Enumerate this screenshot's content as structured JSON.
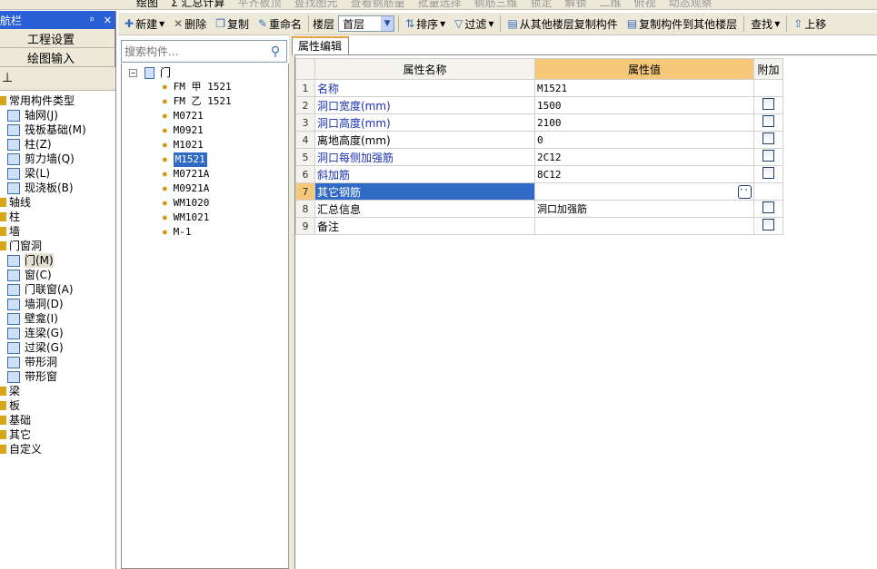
{
  "top_toolbar": [
    "绘图",
    "Σ 汇总计算",
    "平齐板顶",
    "查找图元",
    "查看钢筋量",
    "批量选择",
    "钢筋三维",
    "锁定",
    "解锁",
    "二维",
    "俯视",
    "动态观察"
  ],
  "nav": {
    "title": "航栏",
    "pin": "ᵖ",
    "close": "✕",
    "buttons": [
      "工程设置",
      "绘图输入"
    ],
    "tool": "⊥",
    "tree": [
      {
        "label": "常用构件类型",
        "type": "open",
        "level": 0
      },
      {
        "label": "轴网(J)",
        "level": 1
      },
      {
        "label": "筏板基础(M)",
        "level": 1
      },
      {
        "label": "柱(Z)",
        "level": 1
      },
      {
        "label": "剪力墙(Q)",
        "level": 1
      },
      {
        "label": "梁(L)",
        "level": 1
      },
      {
        "label": "现浇板(B)",
        "level": 1
      },
      {
        "label": "轴线",
        "type": "folder",
        "level": 0
      },
      {
        "label": "柱",
        "type": "folder",
        "level": 0
      },
      {
        "label": "墙",
        "type": "folder",
        "level": 0
      },
      {
        "label": "门窗洞",
        "type": "open",
        "level": 0
      },
      {
        "label": "门(M)",
        "level": 1,
        "selected": true
      },
      {
        "label": "窗(C)",
        "level": 1
      },
      {
        "label": "门联窗(A)",
        "level": 1
      },
      {
        "label": "墙洞(D)",
        "level": 1
      },
      {
        "label": "壁龛(I)",
        "level": 1
      },
      {
        "label": "连梁(G)",
        "level": 1
      },
      {
        "label": "过梁(G)",
        "level": 1
      },
      {
        "label": "带形洞",
        "level": 1
      },
      {
        "label": "带形窗",
        "level": 1
      },
      {
        "label": "梁",
        "type": "folder",
        "level": 0
      },
      {
        "label": "板",
        "type": "folder",
        "level": 0
      },
      {
        "label": "基础",
        "type": "folder",
        "level": 0
      },
      {
        "label": "其它",
        "type": "folder",
        "level": 0
      },
      {
        "label": "自定义",
        "type": "folder",
        "level": 0
      }
    ]
  },
  "toolbar": {
    "new": "新建",
    "delete": "删除",
    "copy": "复制",
    "rename": "重命名",
    "floor_label": "楼层",
    "floor_value": "首层",
    "sort": "排序",
    "filter": "过滤",
    "copy_from": "从其他楼层复制构件",
    "copy_to": "复制构件到其他楼层",
    "find": "查找",
    "move_up": "上移"
  },
  "search": {
    "placeholder": "搜索构件..."
  },
  "component_tree": {
    "root": "门",
    "items": [
      "FM 甲 1521",
      "FM 乙 1521",
      "M0721",
      "M0921",
      "M1021",
      "M1521",
      "M0721A",
      "M0921A",
      "WM1020",
      "WM1021",
      "M-1"
    ],
    "selected": "M1521"
  },
  "property": {
    "tab": "属性编辑",
    "headers": [
      "属性名称",
      "属性值",
      "附加"
    ],
    "rows": [
      {
        "n": "1",
        "name": "名称",
        "value": "M1521",
        "blue": true,
        "checkbox": false
      },
      {
        "n": "2",
        "name": "洞口宽度(mm)",
        "value": "1500",
        "blue": true,
        "checkbox": true
      },
      {
        "n": "3",
        "name": "洞口高度(mm)",
        "value": "2100",
        "blue": true,
        "checkbox": true
      },
      {
        "n": "4",
        "name": "离地高度(mm)",
        "value": "0",
        "blue": false,
        "checkbox": true
      },
      {
        "n": "5",
        "name": "洞口每侧加强筋",
        "value": "2C12",
        "blue": true,
        "checkbox": true
      },
      {
        "n": "6",
        "name": "斜加筋",
        "value": "8C12",
        "blue": true,
        "checkbox": true
      },
      {
        "n": "7",
        "name": "其它钢筋",
        "value": "",
        "blue": false,
        "checkbox": false,
        "selected": true,
        "ellipsis": "···"
      },
      {
        "n": "8",
        "name": "汇总信息",
        "value": "洞口加强筋",
        "blue": false,
        "checkbox": true
      },
      {
        "n": "9",
        "name": "备注",
        "value": "",
        "blue": false,
        "checkbox": true
      }
    ]
  },
  "colors": {
    "accent": "#316ac5",
    "header_value": "#f5c87a",
    "nav_title": "#2a5fd8",
    "link_text": "#1a2fb0"
  }
}
